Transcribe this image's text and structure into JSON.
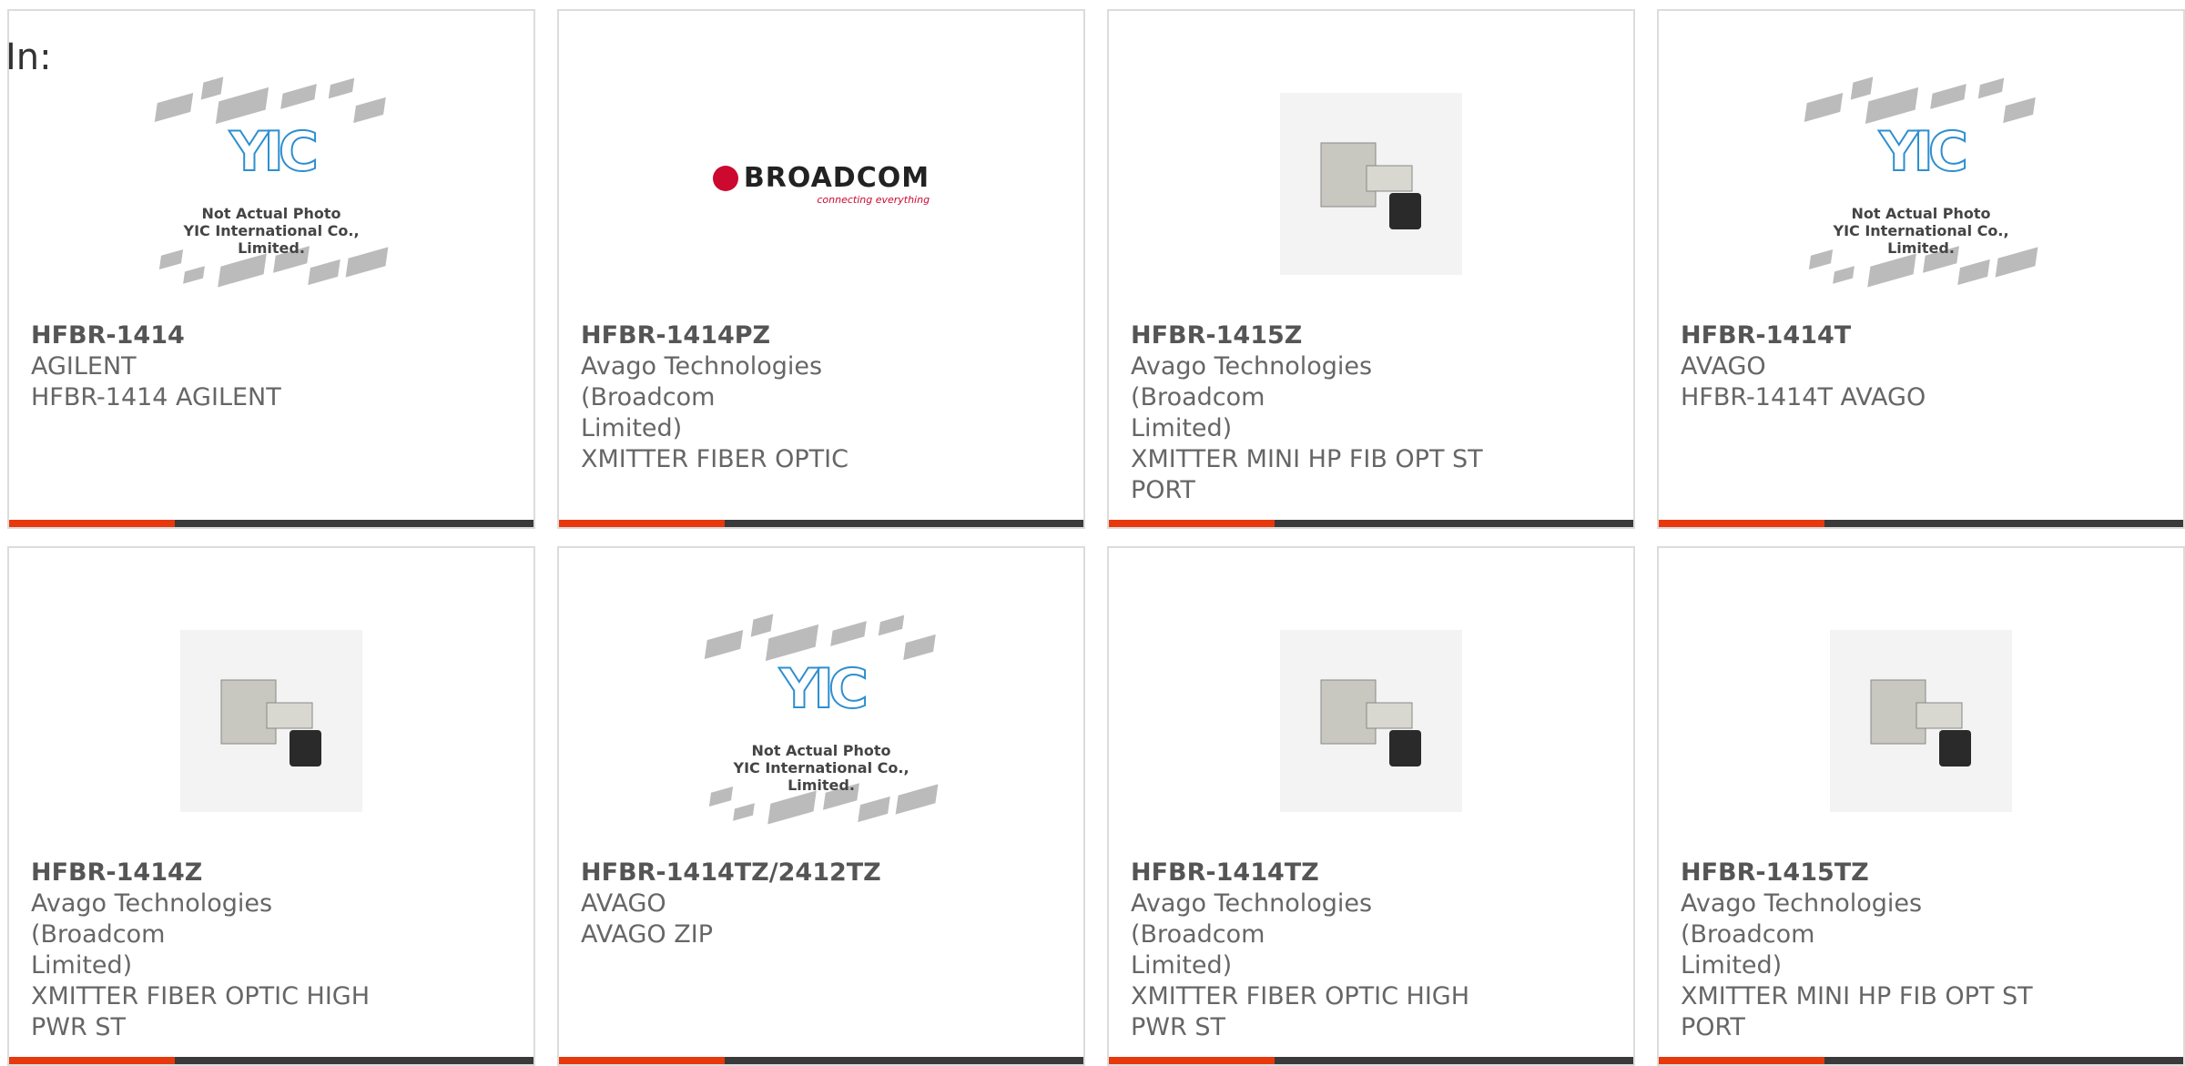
{
  "header": {
    "in_label": "In:"
  },
  "placeholder": {
    "line1": "Not Actual Photo",
    "line2": "YIC International Co., Limited."
  },
  "brand": {
    "accent": "#e8380d",
    "bar": "#3a3a3a",
    "broadcom_red": "#cc092f",
    "broadcom_tag": "connecting everything"
  },
  "products": [
    {
      "part": "HFBR-1414",
      "mfr_lines": [
        "AGILENT"
      ],
      "desc_lines": [
        "HFBR-1414 AGILENT"
      ],
      "image": "placeholder"
    },
    {
      "part": "HFBR-1414PZ",
      "mfr_lines": [
        "Avago Technologies (Broadcom",
        "Limited)"
      ],
      "desc_lines": [
        "XMITTER FIBER OPTIC"
      ],
      "image": "broadcom-logo"
    },
    {
      "part": "HFBR-1415Z",
      "mfr_lines": [
        "Avago Technologies (Broadcom",
        "Limited)"
      ],
      "desc_lines": [
        "XMITTER MINI HP FIB OPT ST",
        "PORT"
      ],
      "image": "photo"
    },
    {
      "part": "HFBR-1414T",
      "mfr_lines": [
        "AVAGO"
      ],
      "desc_lines": [
        "HFBR-1414T AVAGO"
      ],
      "image": "placeholder"
    },
    {
      "part": "HFBR-1414Z",
      "mfr_lines": [
        "Avago Technologies (Broadcom",
        "Limited)"
      ],
      "desc_lines": [
        "XMITTER FIBER OPTIC HIGH",
        "PWR ST"
      ],
      "image": "photo"
    },
    {
      "part": "HFBR-1414TZ/2412TZ",
      "mfr_lines": [
        "AVAGO"
      ],
      "desc_lines": [
        "AVAGO ZIP"
      ],
      "image": "placeholder"
    },
    {
      "part": "HFBR-1414TZ",
      "mfr_lines": [
        "Avago Technologies (Broadcom",
        "Limited)"
      ],
      "desc_lines": [
        "XMITTER FIBER OPTIC HIGH",
        "PWR ST"
      ],
      "image": "photo"
    },
    {
      "part": "HFBR-1415TZ",
      "mfr_lines": [
        "Avago Technologies (Broadcom",
        "Limited)"
      ],
      "desc_lines": [
        "XMITTER MINI HP FIB OPT ST",
        "PORT"
      ],
      "image": "photo"
    }
  ]
}
